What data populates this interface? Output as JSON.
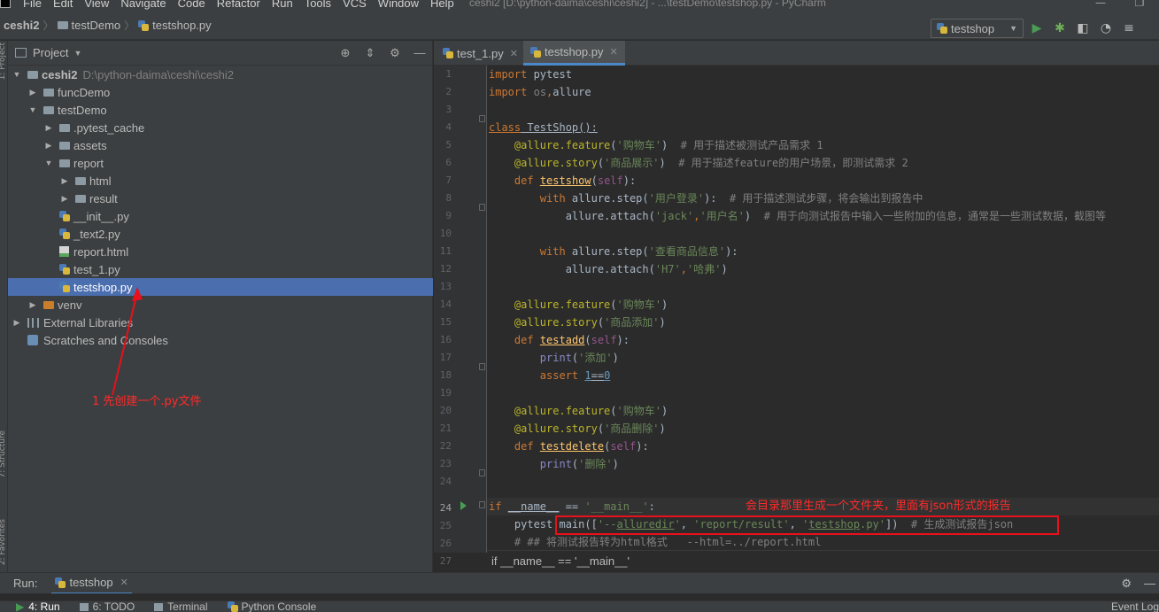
{
  "menubar": {
    "items": [
      "File",
      "Edit",
      "View",
      "Navigate",
      "Code",
      "Refactor",
      "Run",
      "Tools",
      "VCS",
      "Window",
      "Help"
    ],
    "window_title": "ceshi2 [D:\\python-daima\\ceshi\\ceshi2] - ...\\testDemo\\testshop.py - PyCharm"
  },
  "navbar": {
    "crumbs": [
      "ceshi2",
      "testDemo",
      "testshop.py"
    ],
    "run_config": "testshop"
  },
  "left_stripe": {
    "labels": [
      "1: Project",
      "7: Structure",
      "2: Favorites"
    ]
  },
  "project_panel": {
    "title": "Project",
    "tree": [
      {
        "label": "ceshi2",
        "path": "D:\\python-daima\\ceshi\\ceshi2"
      },
      {
        "label": "funcDemo"
      },
      {
        "label": "testDemo"
      },
      {
        "label": ".pytest_cache"
      },
      {
        "label": "assets"
      },
      {
        "label": "report"
      },
      {
        "label": "html"
      },
      {
        "label": "result"
      },
      {
        "label": "__init__.py"
      },
      {
        "label": "_text2.py"
      },
      {
        "label": "report.html"
      },
      {
        "label": "test_1.py"
      },
      {
        "label": "testshop.py"
      },
      {
        "label": "venv"
      },
      {
        "label": "External Libraries"
      },
      {
        "label": "Scratches and Consoles"
      }
    ],
    "annotation": "1 先创建一个.py文件"
  },
  "editor": {
    "tabs": [
      "test_1.py",
      "testshop.py"
    ],
    "line_numbers": [
      "1",
      "2",
      "3",
      "4",
      "5",
      "6",
      "7",
      "8",
      "9",
      "10",
      "11",
      "12",
      "13",
      "14",
      "15",
      "16",
      "17",
      "18",
      "19",
      "20",
      "21",
      "22",
      "23",
      "24",
      "25",
      "26",
      "27"
    ],
    "breadcrumb": "if __name__ == '__main__'",
    "annotation": "会目录那里生成一个文件夹，里面有json形式的报告"
  },
  "run_panel": {
    "label": "Run:",
    "tab": "testshop"
  },
  "status_bar": {
    "tabs": [
      "4: Run",
      "6: TODO",
      "Terminal",
      "Python Console"
    ],
    "event_log": "Event Log"
  }
}
